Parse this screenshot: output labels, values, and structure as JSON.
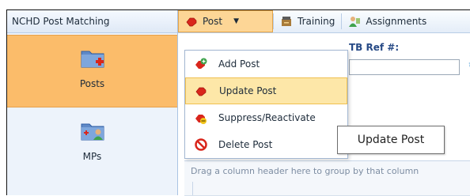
{
  "sidebar": {
    "header": "NCHD Post Matching",
    "items": [
      {
        "label": "Posts",
        "icon": "folder-plus-icon",
        "selected": true
      },
      {
        "label": "MPs",
        "icon": "folder-user-icon",
        "selected": false
      }
    ]
  },
  "toolbar": {
    "post_label": "Post",
    "training_label": "Training",
    "assignments_label": "Assignments"
  },
  "filter": {
    "label": "TB Ref #:",
    "value": ""
  },
  "menu": {
    "items": [
      {
        "label": "Add Post",
        "icon": "add-post-icon"
      },
      {
        "label": "Update Post",
        "icon": "update-post-icon",
        "highlighted": true
      },
      {
        "label": "Suppress/Reactivate",
        "icon": "suppress-icon"
      },
      {
        "label": "Delete Post",
        "icon": "delete-icon"
      }
    ]
  },
  "tooltip": "Update Post",
  "grid": {
    "group_panel_text": "Drag a column header here to group by that column"
  },
  "colors": {
    "accent": "#fbbc6a",
    "sidebar_bg": "#edf3fb",
    "menu_highlight": "#fde7a8",
    "link": "#274a86"
  }
}
